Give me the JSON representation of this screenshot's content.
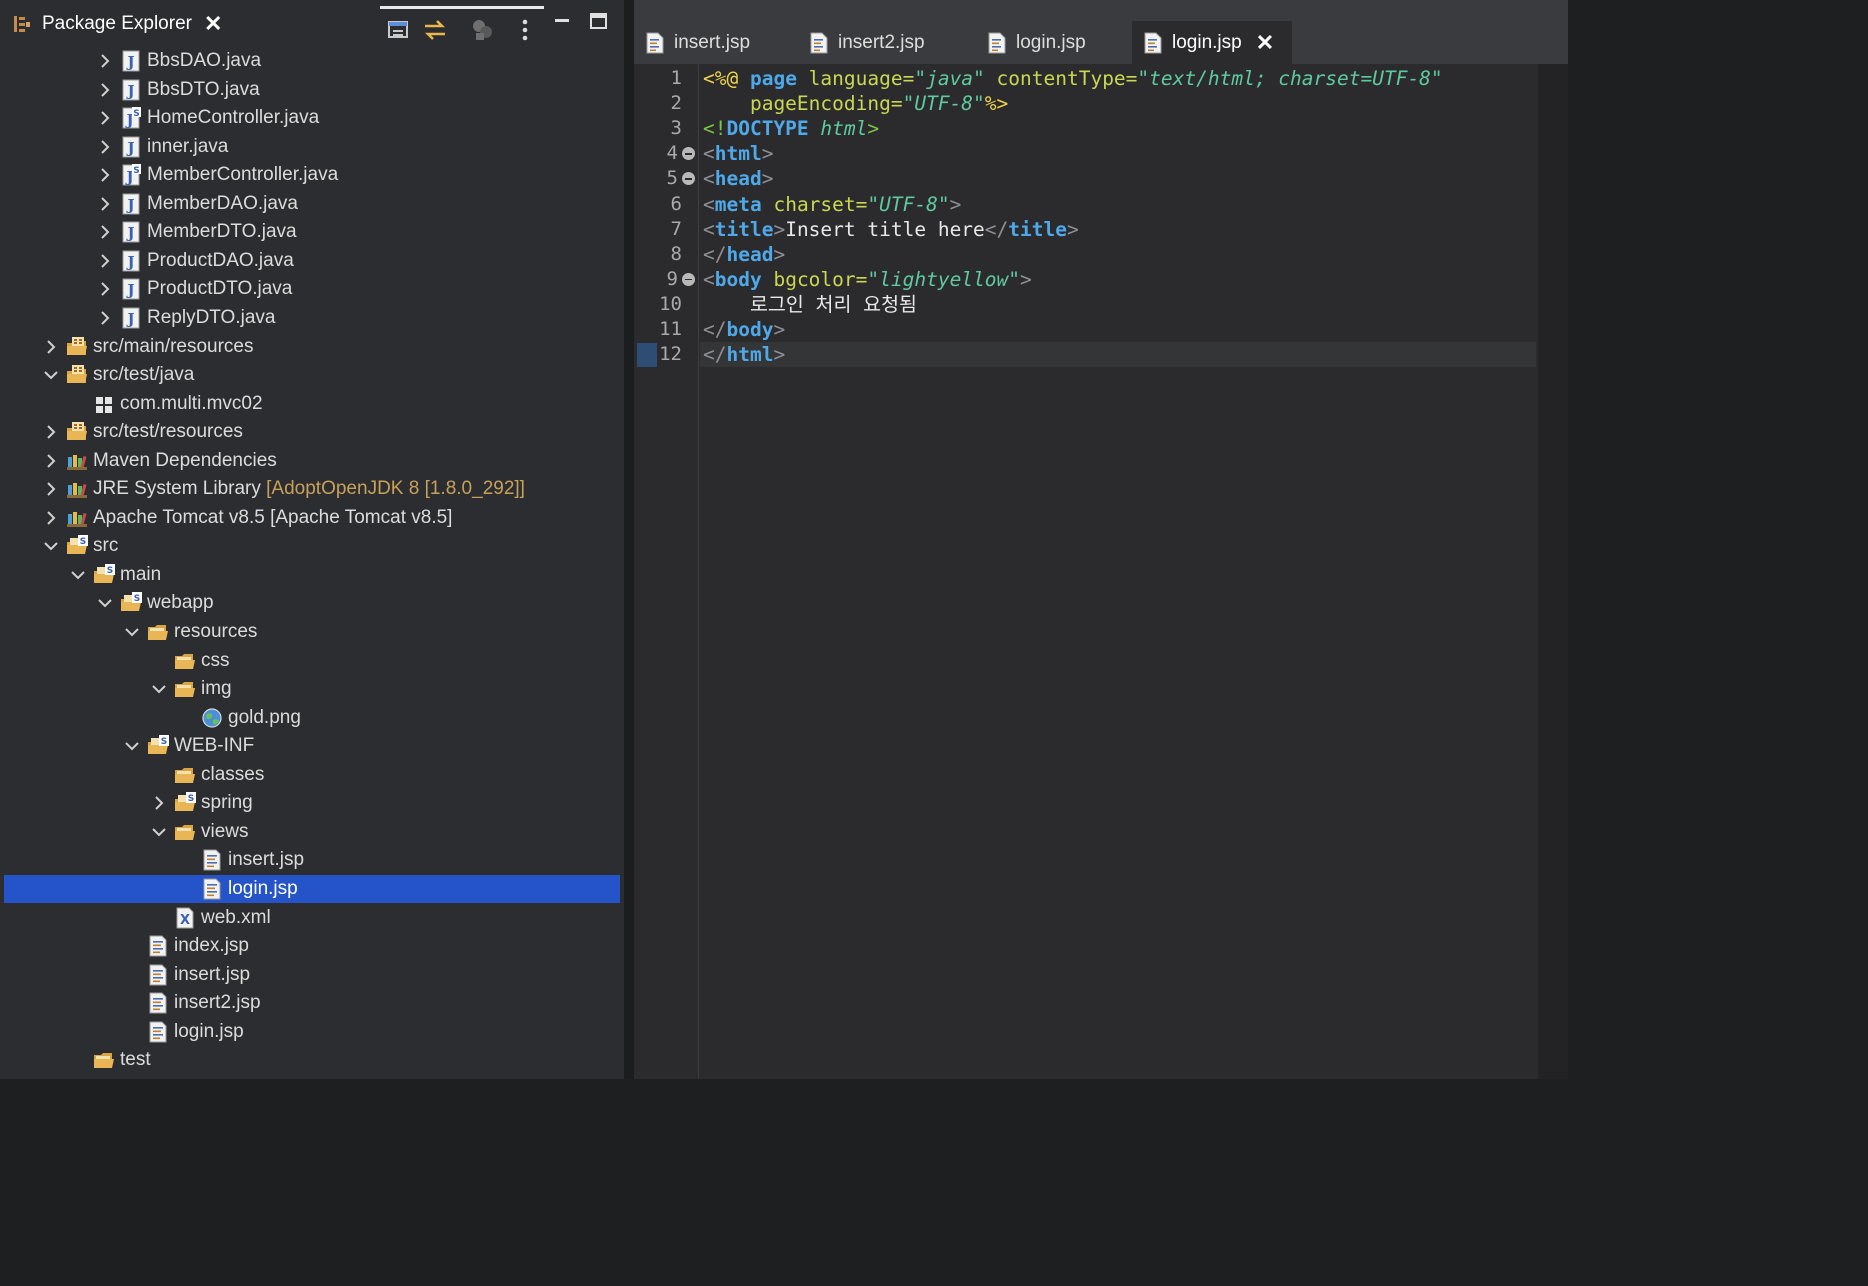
{
  "explorer": {
    "title": "Package Explorer",
    "close_glyph": "✕",
    "rows": [
      {
        "label": "BbsDAO.java",
        "deco": "",
        "icon": "java-file-icon",
        "chev": "right",
        "selected": false
      },
      {
        "label": "BbsDTO.java",
        "deco": "",
        "icon": "java-file-icon",
        "chev": "right",
        "selected": false
      },
      {
        "label": "HomeController.java",
        "deco": "",
        "icon": "java-spring-file-icon",
        "chev": "right",
        "selected": false
      },
      {
        "label": "inner.java",
        "deco": "",
        "icon": "java-file-icon",
        "chev": "right",
        "selected": false
      },
      {
        "label": "MemberController.java",
        "deco": "",
        "icon": "java-spring-file-icon",
        "chev": "right",
        "selected": false
      },
      {
        "label": "MemberDAO.java",
        "deco": "",
        "icon": "java-file-icon",
        "chev": "right",
        "selected": false
      },
      {
        "label": "MemberDTO.java",
        "deco": "",
        "icon": "java-file-icon",
        "chev": "right",
        "selected": false
      },
      {
        "label": "ProductDAO.java",
        "deco": "",
        "icon": "java-file-icon",
        "chev": "right",
        "selected": false
      },
      {
        "label": "ProductDTO.java",
        "deco": "",
        "icon": "java-file-icon",
        "chev": "right",
        "selected": false
      },
      {
        "label": "ReplyDTO.java",
        "deco": "",
        "icon": "java-file-icon",
        "chev": "right",
        "selected": false
      },
      {
        "label": "src/main/resources",
        "deco": "",
        "icon": "source-folder-icon",
        "chev": "right",
        "selected": false
      },
      {
        "label": "src/test/java",
        "deco": "",
        "icon": "source-folder-icon",
        "chev": "down",
        "selected": false
      },
      {
        "label": "com.multi.mvc02",
        "deco": "",
        "icon": "package-icon",
        "chev": "none",
        "selected": false
      },
      {
        "label": "src/test/resources",
        "deco": "",
        "icon": "source-folder-icon",
        "chev": "right",
        "selected": false
      },
      {
        "label": "Maven Dependencies",
        "deco": "",
        "icon": "library-icon",
        "chev": "right",
        "selected": false
      },
      {
        "label": "JRE System Library",
        "deco": "[AdoptOpenJDK 8 [1.8.0_292]]",
        "icon": "library-icon",
        "chev": "right",
        "selected": false
      },
      {
        "label": "Apache Tomcat v8.5 [Apache Tomcat v8.5]",
        "deco": "",
        "icon": "library-icon",
        "chev": "right",
        "selected": false
      },
      {
        "label": "src",
        "deco": "",
        "icon": "spring-folder-icon",
        "chev": "down",
        "selected": false
      },
      {
        "label": "main",
        "deco": "",
        "icon": "spring-folder-icon",
        "chev": "down",
        "selected": false
      },
      {
        "label": "webapp",
        "deco": "",
        "icon": "spring-folder-icon",
        "chev": "down",
        "selected": false
      },
      {
        "label": "resources",
        "deco": "",
        "icon": "folder-icon",
        "chev": "down",
        "selected": false
      },
      {
        "label": "css",
        "deco": "",
        "icon": "folder-icon",
        "chev": "none",
        "selected": false
      },
      {
        "label": "img",
        "deco": "",
        "icon": "folder-icon",
        "chev": "down",
        "selected": false
      },
      {
        "label": "gold.png",
        "deco": "",
        "icon": "image-file-icon",
        "chev": "none",
        "selected": false
      },
      {
        "label": "WEB-INF",
        "deco": "",
        "icon": "spring-folder-icon",
        "chev": "down",
        "selected": false
      },
      {
        "label": "classes",
        "deco": "",
        "icon": "folder-icon",
        "chev": "none",
        "selected": false
      },
      {
        "label": "spring",
        "deco": "",
        "icon": "spring-folder-icon",
        "chev": "right",
        "selected": false
      },
      {
        "label": "views",
        "deco": "",
        "icon": "folder-icon",
        "chev": "down",
        "selected": false
      },
      {
        "label": "insert.jsp",
        "deco": "",
        "icon": "jsp-file-icon",
        "chev": "none",
        "selected": false
      },
      {
        "label": "login.jsp",
        "deco": "",
        "icon": "jsp-file-icon",
        "chev": "none",
        "selected": true
      },
      {
        "label": "web.xml",
        "deco": "",
        "icon": "xml-file-icon",
        "chev": "none",
        "selected": false
      },
      {
        "label": "index.jsp",
        "deco": "",
        "icon": "jsp-file-icon",
        "chev": "none",
        "selected": false
      },
      {
        "label": "insert.jsp",
        "deco": "",
        "icon": "jsp-file-icon",
        "chev": "none",
        "selected": false
      },
      {
        "label": "insert2.jsp",
        "deco": "",
        "icon": "jsp-file-icon",
        "chev": "none",
        "selected": false
      },
      {
        "label": "login.jsp",
        "deco": "",
        "icon": "jsp-file-icon",
        "chev": "none",
        "selected": false
      },
      {
        "label": "test",
        "deco": "",
        "icon": "folder-icon",
        "chev": "none",
        "selected": false
      }
    ]
  },
  "editor": {
    "tabs": [
      {
        "label": "insert.jsp",
        "active": false
      },
      {
        "label": "insert2.jsp",
        "active": false
      },
      {
        "label": "login.jsp",
        "active": false
      },
      {
        "label": "login.jsp",
        "active": true
      }
    ],
    "close_glyph": "✕",
    "lines": [
      {
        "num": "1",
        "fold": false,
        "tokens": [
          [
            "dir",
            "<%@ "
          ],
          [
            "dirkw",
            "page"
          ],
          [
            "attr",
            " language="
          ],
          [
            "val",
            "\"java\""
          ],
          [
            "attr",
            " contentType="
          ],
          [
            "val",
            "\"text/html; charset=UTF-8\""
          ]
        ]
      },
      {
        "num": "2",
        "fold": false,
        "tokens": [
          [
            "attr",
            "    pageEncoding="
          ],
          [
            "val",
            "\"UTF-8\""
          ],
          [
            "dir",
            "%>"
          ]
        ]
      },
      {
        "num": "3",
        "fold": false,
        "tokens": [
          [
            "doc",
            "<!"
          ],
          [
            "dirkw",
            "DOCTYPE"
          ],
          [
            "val2",
            " html"
          ],
          [
            "doc",
            ">"
          ]
        ]
      },
      {
        "num": "4",
        "fold": true,
        "tokens": [
          [
            "br",
            "<"
          ],
          [
            "tag",
            "html"
          ],
          [
            "br",
            ">"
          ]
        ]
      },
      {
        "num": "5",
        "fold": true,
        "tokens": [
          [
            "br",
            "<"
          ],
          [
            "tag",
            "head"
          ],
          [
            "br",
            ">"
          ]
        ]
      },
      {
        "num": "6",
        "fold": false,
        "tokens": [
          [
            "br",
            "<"
          ],
          [
            "tag",
            "meta"
          ],
          [
            "attr",
            " charset="
          ],
          [
            "val",
            "\"UTF-8\""
          ],
          [
            "br",
            ">"
          ]
        ]
      },
      {
        "num": "7",
        "fold": false,
        "tokens": [
          [
            "br",
            "<"
          ],
          [
            "tag",
            "title"
          ],
          [
            "br",
            ">"
          ],
          [
            "txt",
            "Insert title here"
          ],
          [
            "br",
            "</"
          ],
          [
            "tag",
            "title"
          ],
          [
            "br",
            ">"
          ]
        ]
      },
      {
        "num": "8",
        "fold": false,
        "tokens": [
          [
            "br",
            "</"
          ],
          [
            "tag",
            "head"
          ],
          [
            "br",
            ">"
          ]
        ]
      },
      {
        "num": "9",
        "fold": true,
        "tokens": [
          [
            "br",
            "<"
          ],
          [
            "tag",
            "body"
          ],
          [
            "attr",
            " bgcolor="
          ],
          [
            "val",
            "\"lightyellow\""
          ],
          [
            "br",
            ">"
          ]
        ]
      },
      {
        "num": "10",
        "fold": false,
        "tokens": [
          [
            "txt",
            "    로그인 처리 요청됨"
          ]
        ]
      },
      {
        "num": "11",
        "fold": false,
        "tokens": [
          [
            "br",
            "</"
          ],
          [
            "tag",
            "body"
          ],
          [
            "br",
            ">"
          ]
        ]
      },
      {
        "num": "12",
        "fold": false,
        "tokens": [
          [
            "br",
            "</"
          ],
          [
            "tag",
            "html"
          ],
          [
            "br",
            ">"
          ]
        ]
      }
    ]
  },
  "colors": {
    "selection": "#2454c8",
    "tag": "#4fa8e8",
    "attribute": "#c9d852",
    "value": "#5fc9a0",
    "directive": "#f0d44a",
    "deco": "#c7a15a"
  }
}
